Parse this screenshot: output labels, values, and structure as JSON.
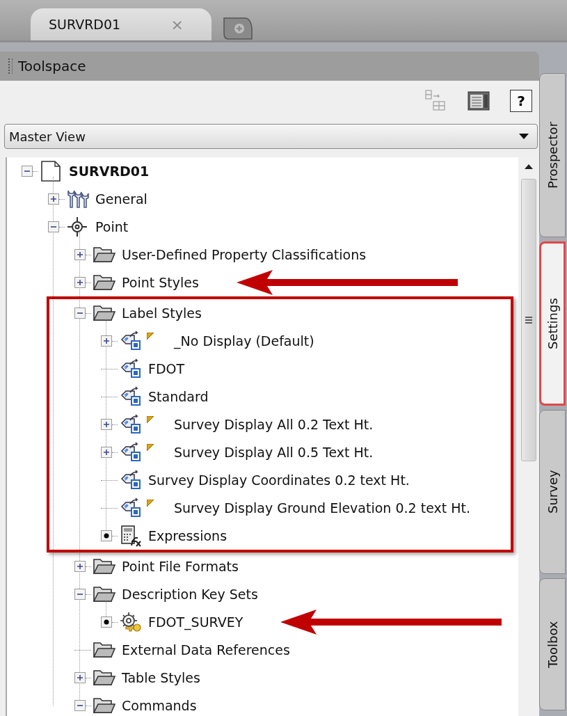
{
  "doc_tabs": [
    {
      "label": "SURVRD01",
      "close": "×",
      "selected": true
    }
  ],
  "palette": {
    "title": "Toolspace",
    "toolbar": [
      {
        "kind": "tree-move",
        "disabled": true
      },
      {
        "kind": "panel",
        "disabled": false
      },
      {
        "kind": "help",
        "label": "?",
        "disabled": false
      }
    ],
    "view_select": {
      "value": "Master View"
    },
    "tree": [
      {
        "label": "SURVRD01",
        "kind": "document",
        "expanded": true,
        "children": [
          {
            "label": "General",
            "kind": "wrenches",
            "expanded": false
          },
          {
            "label": "Point",
            "kind": "crosshair",
            "expanded": true,
            "children": [
              {
                "label": "User-Defined Property Classifications",
                "kind": "folder",
                "expanded": false
              },
              {
                "label": "Point Styles",
                "kind": "folder",
                "expanded": false,
                "callout": true
              },
              {
                "label": "Label Styles",
                "kind": "folder",
                "expanded": true,
                "boxed": true,
                "children": [
                  {
                    "label": "_No Display (Default)",
                    "kind": "label-style",
                    "expanded": false,
                    "flag": true
                  },
                  {
                    "label": "FDOT",
                    "kind": "label-style"
                  },
                  {
                    "label": "Standard",
                    "kind": "label-style"
                  },
                  {
                    "label": "Survey Display All 0.2 Text Ht.",
                    "kind": "label-style",
                    "expanded": false,
                    "flag": true
                  },
                  {
                    "label": "Survey Display All 0.5 Text Ht.",
                    "kind": "label-style",
                    "expanded": false,
                    "flag": true
                  },
                  {
                    "label": "Survey Display Coordinates 0.2 text Ht.",
                    "kind": "label-style"
                  },
                  {
                    "label": "Survey Display Ground Elevation 0.2 text Ht.",
                    "kind": "label-style",
                    "flag": true
                  },
                  {
                    "label": "Expressions",
                    "kind": "calculator",
                    "bullet": true
                  }
                ]
              },
              {
                "label": "Point File Formats",
                "kind": "folder",
                "expanded": false
              },
              {
                "label": "Description Key Sets",
                "kind": "folder",
                "expanded": true,
                "children": [
                  {
                    "label": "FDOT_SURVEY",
                    "kind": "gear-key",
                    "bullet": true,
                    "callout": true
                  }
                ]
              },
              {
                "label": "External Data References",
                "kind": "folder"
              },
              {
                "label": "Table Styles",
                "kind": "folder",
                "expanded": false
              },
              {
                "label": "Commands",
                "kind": "folder",
                "expanded": true
              }
            ]
          }
        ]
      }
    ],
    "side_tabs": [
      {
        "label": "Prospector",
        "selected": false,
        "highlighted": false
      },
      {
        "label": "Settings",
        "selected": true,
        "highlighted": true
      },
      {
        "label": "Survey",
        "selected": false,
        "highlighted": false
      },
      {
        "label": "Toolbox",
        "selected": false,
        "highlighted": false
      }
    ]
  }
}
